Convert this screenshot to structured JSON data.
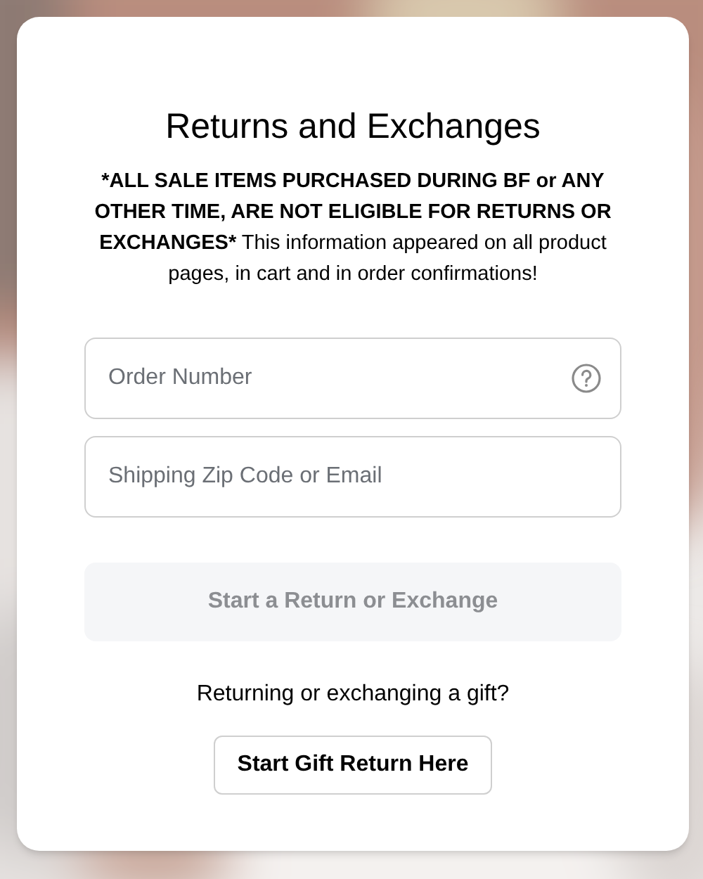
{
  "title": "Returns and Exchanges",
  "notice": {
    "bold": "*ALL SALE ITEMS PURCHASED DURING BF or ANY OTHER TIME, ARE NOT ELIGIBLE FOR RETURNS OR EXCHANGES*",
    "rest": " This information appeared on all product pages, in cart and in order confirmations!"
  },
  "fields": [
    {
      "placeholder": "Order Number",
      "help": true
    },
    {
      "placeholder": "Shipping Zip Code or Email",
      "help": false
    }
  ],
  "submit": {
    "label": "Start a Return or Exchange",
    "disabled": true
  },
  "gift": {
    "question": "Returning or exchanging a gift?",
    "button": "Start Gift Return Here"
  }
}
